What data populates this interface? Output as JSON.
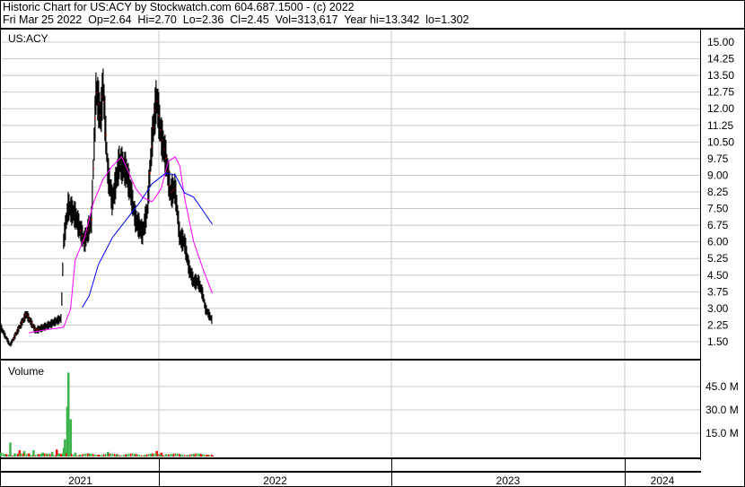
{
  "header": {
    "title": "Historic Chart for US:ACY by Stockwatch.com 604.687.1500 - (c) 2022",
    "quote": "Fri Mar 25 2022  Op=2.64  Hi=2.70  Lo=2.36  Cl=2.45  Vol=313,617  Year hi=13.342  lo=1.302"
  },
  "colors": {
    "price": "#000000",
    "ma_short": "#ff00ff",
    "ma_long": "#0000ff",
    "vol_up": "#3cb34a",
    "vol_down": "#ff0000",
    "grid": "#c8c8c8"
  },
  "chart_data": [
    {
      "type": "line",
      "title": "US:ACY",
      "ylim": [
        1.0,
        15.5
      ],
      "yticks": [
        "15.00",
        "14.25",
        "13.50",
        "12.75",
        "12.00",
        "11.25",
        "10.50",
        "9.75",
        "9.00",
        "8.25",
        "7.50",
        "6.75",
        "6.00",
        "5.25",
        "4.50",
        "3.75",
        "3.00",
        "2.25",
        "1.50"
      ],
      "ytick_values": [
        15,
        14.25,
        13.5,
        12.75,
        12,
        11.25,
        10.5,
        9.75,
        9,
        8.25,
        7.5,
        6.75,
        6,
        5.25,
        4.5,
        3.75,
        3,
        2.25,
        1.5
      ],
      "xticks": [
        "2021",
        "2022",
        "2023",
        "2024"
      ],
      "series": [
        {
          "name": "price",
          "x": [
            2021.32,
            2021.36,
            2021.43,
            2021.47,
            2021.53,
            2021.58,
            2021.59,
            2021.61,
            2021.64,
            2021.68,
            2021.71,
            2021.73,
            2021.75,
            2021.76,
            2021.78,
            2021.8,
            2021.83,
            2021.86,
            2021.88,
            2021.9,
            2021.93,
            2021.95,
            2021.97,
            2021.99,
            2022.01,
            2022.03,
            2022.05,
            2022.07,
            2022.09,
            2022.11,
            2022.13,
            2022.15,
            2022.17,
            2022.19,
            2022.2,
            2022.23
          ],
          "y": [
            2.15,
            1.34,
            2.75,
            2.0,
            2.27,
            2.55,
            6.0,
            7.6,
            7.2,
            6.0,
            7.0,
            12.9,
            11.6,
            13.1,
            9.2,
            7.8,
            9.6,
            9.2,
            8.2,
            7.0,
            6.4,
            7.4,
            10.5,
            12.5,
            10.8,
            9.8,
            8.2,
            8.4,
            6.2,
            6.0,
            4.8,
            4.2,
            4.2,
            3.6,
            3.0,
            2.45
          ]
        },
        {
          "name": "ma_short",
          "x": [
            2021.44,
            2021.51,
            2021.59,
            2021.62,
            2021.64,
            2021.68,
            2021.72,
            2021.76,
            2021.8,
            2021.84,
            2021.87,
            2021.9,
            2021.93,
            2021.97,
            2021.98,
            2022.01,
            2022.04,
            2022.07,
            2022.09,
            2022.11,
            2022.13,
            2022.15,
            2022.19,
            2022.23
          ],
          "y": [
            1.9,
            2.03,
            2.15,
            2.96,
            5.18,
            6.19,
            7.81,
            8.82,
            9.42,
            9.83,
            9.14,
            8.41,
            8.01,
            7.81,
            7.93,
            8.41,
            9.62,
            9.83,
            9.42,
            8.01,
            7.0,
            5.99,
            4.77,
            3.68
          ]
        },
        {
          "name": "ma_long",
          "x": [
            2021.67,
            2021.7,
            2021.74,
            2021.8,
            2021.86,
            2021.92,
            2021.97,
            2022.03,
            2022.07,
            2022.11,
            2022.15,
            2022.19,
            2022.23
          ],
          "y": [
            3.04,
            3.56,
            4.98,
            6.19,
            7.0,
            7.81,
            8.61,
            9.1,
            9.02,
            8.21,
            8.01,
            7.4,
            6.79
          ]
        }
      ]
    },
    {
      "type": "bar",
      "title": "Volume",
      "ylim": [
        0,
        52
      ],
      "unit": "M",
      "yticks": [
        "45.0 M",
        "30.0 M",
        "15.0 M"
      ],
      "ytick_values": [
        45,
        30,
        15
      ],
      "x": [
        2021.32,
        2021.34,
        2021.36,
        2021.38,
        2021.4,
        2021.42,
        2021.44,
        2021.46,
        2021.48,
        2021.5,
        2021.52,
        2021.54,
        2021.56,
        2021.57,
        2021.58,
        2021.59,
        2021.595,
        2021.6,
        2021.605,
        2021.61,
        2021.62,
        2021.64,
        2021.66,
        2021.7,
        2021.74,
        2021.78,
        2021.82,
        2021.86,
        2021.9,
        2021.94,
        2021.97,
        2021.99,
        2022.01,
        2022.03,
        2022.06,
        2022.09,
        2022.12,
        2022.15,
        2022.18,
        2022.21,
        2022.23
      ],
      "values": [
        2.5,
        1.5,
        9,
        2,
        4,
        3.5,
        2,
        4,
        1.5,
        2.5,
        1.5,
        3,
        4.5,
        2,
        1.5,
        5.5,
        11,
        4,
        32,
        54,
        24,
        2.5,
        1.2,
        2,
        1.2,
        3,
        1.5,
        0.8,
        0.8,
        0.8,
        1.5,
        3.5,
        2.5,
        1.5,
        0.8,
        0.8,
        0.8,
        0.8,
        1.2,
        1.2,
        0.6
      ],
      "up": [
        1,
        0,
        1,
        1,
        0,
        1,
        0,
        1,
        0,
        1,
        0,
        1,
        0,
        1,
        0,
        1,
        1,
        1,
        1,
        1,
        1,
        1,
        0,
        1,
        0,
        1,
        0,
        0,
        0,
        0,
        1,
        0,
        0,
        1,
        0,
        0,
        0,
        0,
        0,
        0,
        0
      ]
    }
  ]
}
